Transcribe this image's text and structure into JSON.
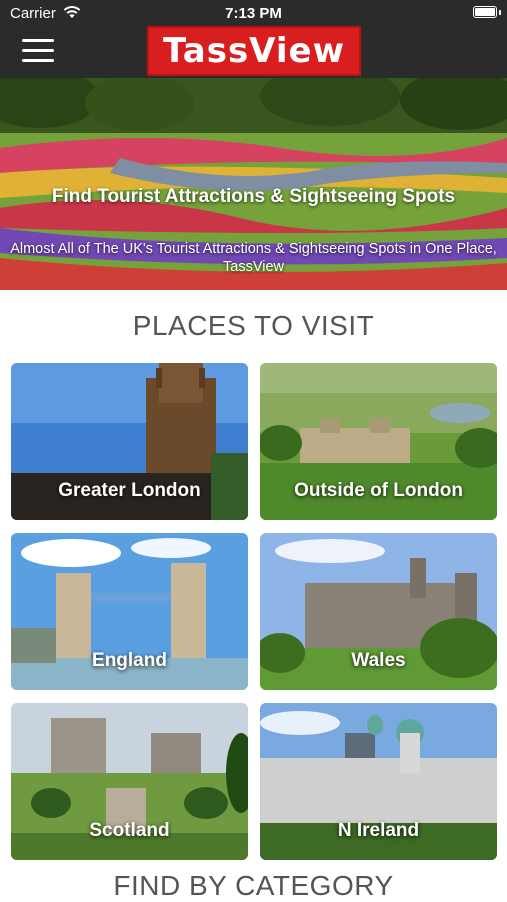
{
  "status_bar": {
    "carrier": "Carrier",
    "time": "7:13 PM"
  },
  "header": {
    "logo": "TassView",
    "menu_icon": "hamburger-menu-icon"
  },
  "hero": {
    "title": "Find Tourist Attractions & Sightseeing Spots",
    "subtitle": "Almost All of The UK's Tourist Attractions & Sightseeing Spots in One Place, TassView"
  },
  "places": {
    "heading": "PLACES TO VISIT",
    "items": [
      {
        "label": "Greater London"
      },
      {
        "label": "Outside of London"
      },
      {
        "label": "England"
      },
      {
        "label": "Wales"
      },
      {
        "label": "Scotland"
      },
      {
        "label": "N Ireland"
      }
    ]
  },
  "category": {
    "heading": "FIND BY CATEGORY"
  },
  "colors": {
    "bar": "#2b2b2b",
    "logo_red": "#d81e1e",
    "heading_gray": "#555555"
  }
}
